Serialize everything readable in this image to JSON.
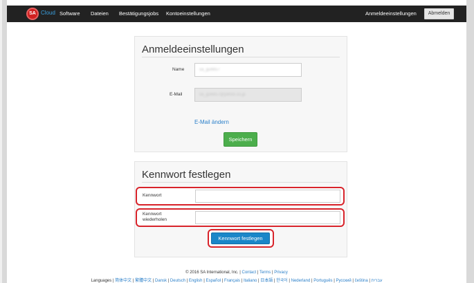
{
  "navbar": {
    "logo_mark": "SA",
    "logo_text": "Cloud",
    "items": [
      "Software",
      "Dateien",
      "Bestätigungsjobs",
      "Kontoeinstellungen"
    ],
    "right_link": "Anmeldeeinstellungen",
    "logout_label": "Abmelden"
  },
  "login_settings": {
    "title": "Anmeldeeinstellungen",
    "name_label": "Name",
    "name_value": "sa_gu6657",
    "email_label": "E-Mail",
    "email_value": "sa_gu6657@yahoo.co.jp",
    "change_email_link": "E-Mail ändern",
    "save_label": "Speichern"
  },
  "password": {
    "title": "Kennwort festlegen",
    "password_label": "Kennwort",
    "repeat_label_line1": "Kennwort",
    "repeat_label_line2": "wiederholen",
    "submit_label": "Kennwort festlegen"
  },
  "footer": {
    "copyright": "© 2016 SA International, Inc. |",
    "contact": "Contact",
    "terms": "Terms",
    "privacy": "Privacy",
    "languages_label": "Languages |",
    "languages": [
      "简体中文",
      "繁體中文",
      "Dansk",
      "Deutsch",
      "English",
      "Español",
      "Français",
      "Italiano",
      "日本語",
      "한국어",
      "Nederland",
      "Português",
      "Русский",
      "čeština",
      "עברית"
    ]
  },
  "colors": {
    "navbar_bg": "#222222",
    "accent_link": "#2a7fc9",
    "save_green": "#4cae4c",
    "primary_blue": "#1a86c8",
    "highlight_red": "#d8232a"
  }
}
